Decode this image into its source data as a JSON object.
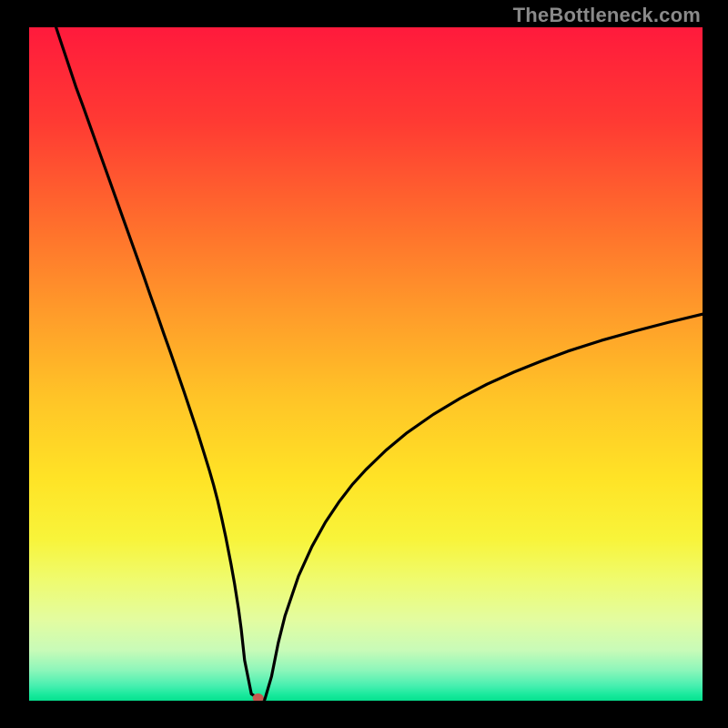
{
  "watermark": "TheBottleneck.com",
  "chart_data": {
    "type": "line",
    "title": "",
    "xlabel": "",
    "ylabel": "",
    "x_range": [
      0,
      100
    ],
    "y_range": [
      0,
      100
    ],
    "gradient_stops": [
      {
        "offset": "0%",
        "color": "#ff1a3c"
      },
      {
        "offset": "14%",
        "color": "#ff3a33"
      },
      {
        "offset": "28%",
        "color": "#ff6a2d"
      },
      {
        "offset": "42%",
        "color": "#ff9a2a"
      },
      {
        "offset": "55%",
        "color": "#ffc427"
      },
      {
        "offset": "67%",
        "color": "#ffe326"
      },
      {
        "offset": "76%",
        "color": "#f8f43a"
      },
      {
        "offset": "82%",
        "color": "#effb6e"
      },
      {
        "offset": "88%",
        "color": "#e3fca0"
      },
      {
        "offset": "92.5%",
        "color": "#c8fbb8"
      },
      {
        "offset": "95.5%",
        "color": "#8cf6ba"
      },
      {
        "offset": "97.8%",
        "color": "#46efb0"
      },
      {
        "offset": "99.2%",
        "color": "#16e99b"
      },
      {
        "offset": "100%",
        "color": "#06e08f"
      }
    ],
    "series": [
      {
        "name": "bottleneck-curve",
        "color": "#000000",
        "x": [
          4,
          5,
          6,
          7,
          8,
          9,
          10,
          11,
          12,
          13,
          14,
          15,
          16,
          17,
          18,
          19,
          20,
          21,
          22,
          23,
          24,
          25,
          26,
          26.8,
          27.4,
          28,
          28.6,
          29.2,
          30,
          30.5,
          31.1,
          31.5,
          32,
          33,
          34,
          35,
          36,
          37,
          38,
          40,
          42,
          44,
          46,
          48,
          50,
          53,
          56,
          60,
          64,
          68,
          72,
          76,
          80,
          85,
          90,
          95,
          100
        ],
        "y": [
          100,
          97,
          94,
          91,
          88.3,
          85.5,
          82.7,
          79.9,
          77.1,
          74.3,
          71.5,
          68.7,
          65.9,
          63.1,
          60.2,
          57.4,
          54.5,
          51.7,
          48.8,
          45.9,
          42.9,
          39.9,
          36.7,
          34.1,
          32,
          29.7,
          27.1,
          24.3,
          20.2,
          17.4,
          13.6,
          10.6,
          6,
          1.0,
          0.4,
          0.2,
          3.6,
          8.6,
          12.6,
          18.5,
          22.9,
          26.5,
          29.5,
          32.1,
          34.3,
          37.2,
          39.7,
          42.5,
          44.9,
          47,
          48.8,
          50.4,
          51.9,
          53.5,
          54.9,
          56.2,
          57.4
        ]
      }
    ],
    "marker": {
      "x": 34,
      "y": 0.4,
      "color": "#c75a4f",
      "rx": 6,
      "ry": 5
    }
  }
}
